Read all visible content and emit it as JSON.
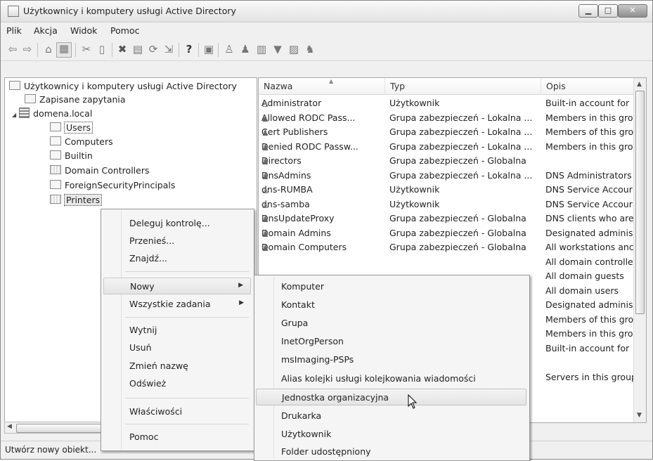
{
  "window": {
    "title": "Użytkownicy i komputery usługi Active Directory",
    "controls": {
      "minimize": "▁",
      "maximize": "□",
      "close": "✕"
    }
  },
  "menubar": [
    "Plik",
    "Akcja",
    "Widok",
    "Pomoc"
  ],
  "toolbar_icons": [
    "back-arrow-icon",
    "forward-arrow-icon",
    "up-folder-icon",
    "show-hide-tree-icon",
    "cut-icon",
    "copy-icon",
    "delete-icon",
    "properties-icon",
    "refresh-icon",
    "export-list-icon",
    "help-icon",
    "console-tree-icon",
    "new-user-icon",
    "new-group-icon",
    "new-ou-icon",
    "filter-icon",
    "find-icon",
    "add-to-group-icon"
  ],
  "tree": {
    "root": "Użytkownicy i komputery usługi Active Directory",
    "saved_queries": "Zapisane zapytania",
    "domain": "domena.local",
    "children": [
      "Users",
      "Computers",
      "Builtin",
      "Domain Controllers",
      "ForeignSecurityPrincipals",
      "Printers"
    ]
  },
  "list": {
    "columns": [
      "Nazwa",
      "Typ",
      "Opis"
    ],
    "rows": [
      {
        "name": "Administrator",
        "type": "Użytkownik",
        "desc": "Built-in account for",
        "icon": "user-icon"
      },
      {
        "name": "Allowed RODC Pass...",
        "type": "Grupa zabezpieczeń - Lokalna ...",
        "desc": "Members in this gro",
        "icon": "group-icon"
      },
      {
        "name": "Cert Publishers",
        "type": "Grupa zabezpieczeń - Lokalna ...",
        "desc": "Members of this gro",
        "icon": "group-icon"
      },
      {
        "name": "Denied RODC Passw...",
        "type": "Grupa zabezpieczeń - Lokalna ...",
        "desc": "Members in this gro",
        "icon": "group-icon"
      },
      {
        "name": "Directors",
        "type": "Grupa zabezpieczeń - Globalna",
        "desc": "",
        "icon": "group-icon"
      },
      {
        "name": "DnsAdmins",
        "type": "Grupa zabezpieczeń - Lokalna ...",
        "desc": "DNS Administrators",
        "icon": "group-icon"
      },
      {
        "name": "dns-RUMBA",
        "type": "Użytkownik",
        "desc": "DNS Service Accour",
        "icon": "user-icon"
      },
      {
        "name": "dns-samba",
        "type": "Użytkownik",
        "desc": "DNS Service Accour",
        "icon": "user-icon"
      },
      {
        "name": "DnsUpdateProxy",
        "type": "Grupa zabezpieczeń - Globalna",
        "desc": "DNS clients who are",
        "icon": "group-icon"
      },
      {
        "name": "Domain Admins",
        "type": "Grupa zabezpieczeń - Globalna",
        "desc": "Designated adminis",
        "icon": "group-icon"
      },
      {
        "name": "Domain Computers",
        "type": "Grupa zabezpieczeń - Globalna",
        "desc": "All workstations anc",
        "icon": "group-icon"
      },
      {
        "name": "",
        "type": "",
        "desc": "All domain controlle",
        "icon": ""
      },
      {
        "name": "",
        "type": "",
        "desc": "All domain guests",
        "icon": ""
      },
      {
        "name": "",
        "type": "",
        "desc": "All domain users",
        "icon": ""
      },
      {
        "name": "",
        "type": "...",
        "desc": "Designated adminis",
        "icon": ""
      },
      {
        "name": "",
        "type": "...",
        "desc": "Members of this gro",
        "icon": ""
      },
      {
        "name": "",
        "type": "",
        "desc": "Members in this gro",
        "icon": ""
      },
      {
        "name": "",
        "type": "",
        "desc": "Built-in account for",
        "icon": ""
      },
      {
        "name": "",
        "type": "",
        "desc": "",
        "icon": ""
      },
      {
        "name": "",
        "type": "",
        "desc": "Servers in this group",
        "icon": ""
      }
    ]
  },
  "context_menu": {
    "items": [
      "Deleguj kontrolę...",
      "Przenieś...",
      "Znajdź...",
      "Nowy",
      "Wszystkie zadania",
      "Wytnij",
      "Usuń",
      "Zmień nazwę",
      "Odśwież",
      "Właściwości",
      "Pomoc"
    ],
    "highlighted": "Nowy"
  },
  "submenu": {
    "items": [
      "Komputer",
      "Kontakt",
      "Grupa",
      "InetOrgPerson",
      "msImaging-PSPs",
      "Alias kolejki usługi kolejkowania wiadomości",
      "Jednostka organizacyjna",
      "Drukarka",
      "Użytkownik",
      "Folder udostępniony"
    ],
    "highlighted": "Jednostka organizacyjna"
  },
  "status": "Utwórz nowy obiekt..."
}
